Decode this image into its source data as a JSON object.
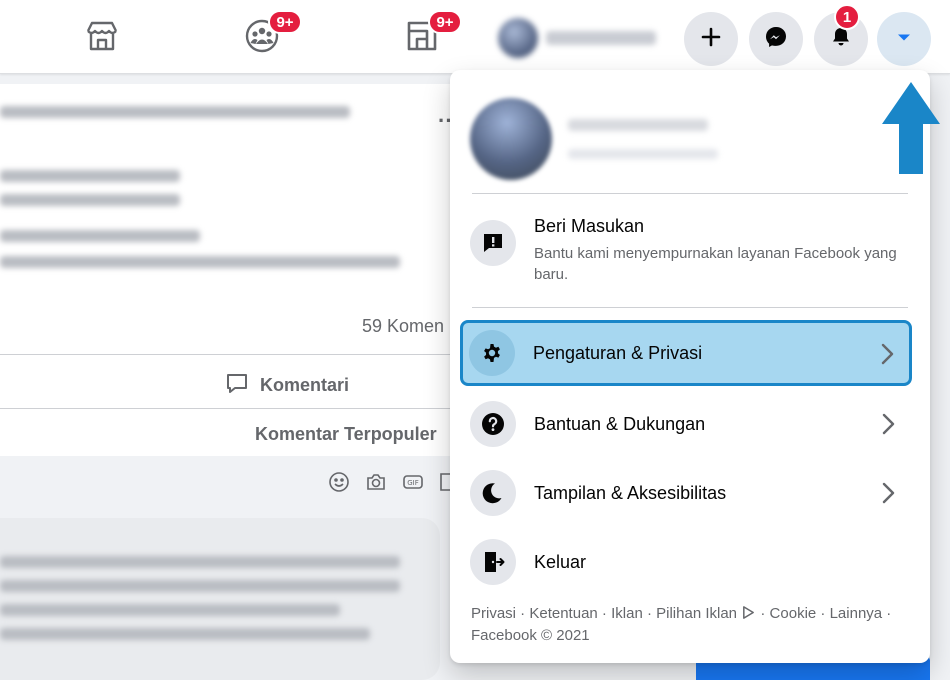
{
  "nav": {
    "marketplace_icon": "shop-icon",
    "groups_icon": "groups-icon",
    "groups_badge": "9+",
    "gaming_icon": "gaming-icon",
    "gaming_badge": "9+",
    "create_icon": "plus-icon",
    "messenger_icon": "messenger-icon",
    "notifications_icon": "bell-icon",
    "notifications_badge": "1",
    "account_icon": "caret-down-icon",
    "account_accent": "#1877f2"
  },
  "feed": {
    "comment_count": "59 Komen",
    "comment_action": "Komentari",
    "sort_label": "Komentar Terpopuler"
  },
  "menu": {
    "feedback_title": "Beri Masukan",
    "feedback_desc": "Bantu kami menyempurnakan layanan Facebook yang baru.",
    "items": [
      {
        "label": "Pengaturan & Privasi",
        "icon": "gear-icon",
        "highlighted": true
      },
      {
        "label": "Bantuan & Dukungan",
        "icon": "question-icon"
      },
      {
        "label": "Tampilan & Aksesibilitas",
        "icon": "moon-icon"
      },
      {
        "label": "Keluar",
        "icon": "logout-icon"
      }
    ],
    "footer": {
      "privacy": "Privasi",
      "terms": "Ketentuan",
      "ads": "Iklan",
      "ad_choices": "Pilihan Iklan",
      "cookies": "Cookie",
      "more": "Lainnya",
      "copyright": "Facebook © 2021"
    }
  },
  "colors": {
    "highlight_fill": "#a7d7f0",
    "highlight_border": "#1a86c8",
    "badge_red": "#e41e3f",
    "annotation_arrow": "#1a86c8"
  }
}
